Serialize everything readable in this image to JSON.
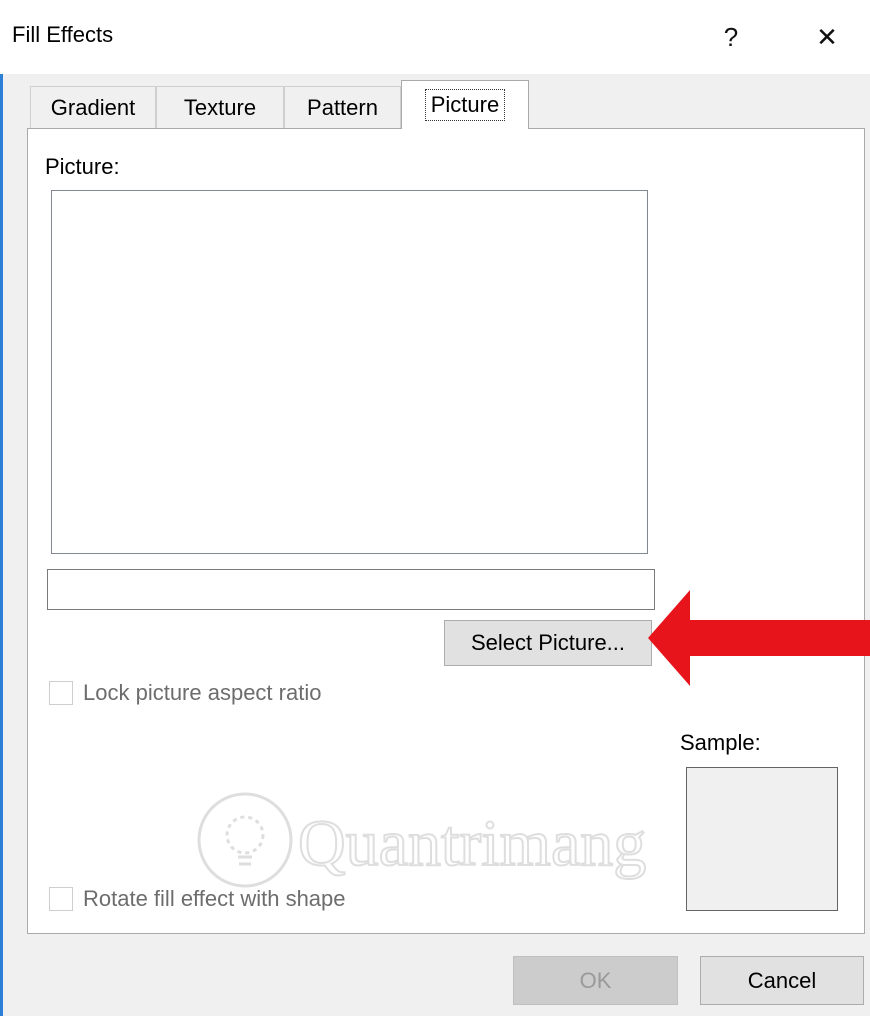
{
  "window": {
    "title": "Fill Effects",
    "help_glyph": "?",
    "close_glyph": "✕"
  },
  "tabs": [
    {
      "label": "Gradient",
      "active": false
    },
    {
      "label": "Texture",
      "active": false
    },
    {
      "label": "Pattern",
      "active": false
    },
    {
      "label": "Picture",
      "active": true
    }
  ],
  "picture_tab": {
    "picture_label": "Picture:",
    "path_value": "",
    "select_button_label": "Select Picture...",
    "lock_aspect_label": "Lock picture aspect ratio",
    "lock_aspect_checked": false,
    "rotate_label": "Rotate fill effect with shape",
    "rotate_checked": false,
    "sample_label": "Sample:"
  },
  "annotation": {
    "arrow_color": "#e8141b",
    "arrow_icon": "red-arrow-left-icon"
  },
  "watermark": {
    "text": "Quantrimang",
    "icon": "lightbulb-icon"
  },
  "footer": {
    "ok_label": "OK",
    "ok_enabled": false,
    "cancel_label": "Cancel"
  },
  "colors": {
    "accent": "#2b7fd6",
    "panel_bg": "#ffffff",
    "dialog_bg": "#f0f0f0"
  }
}
